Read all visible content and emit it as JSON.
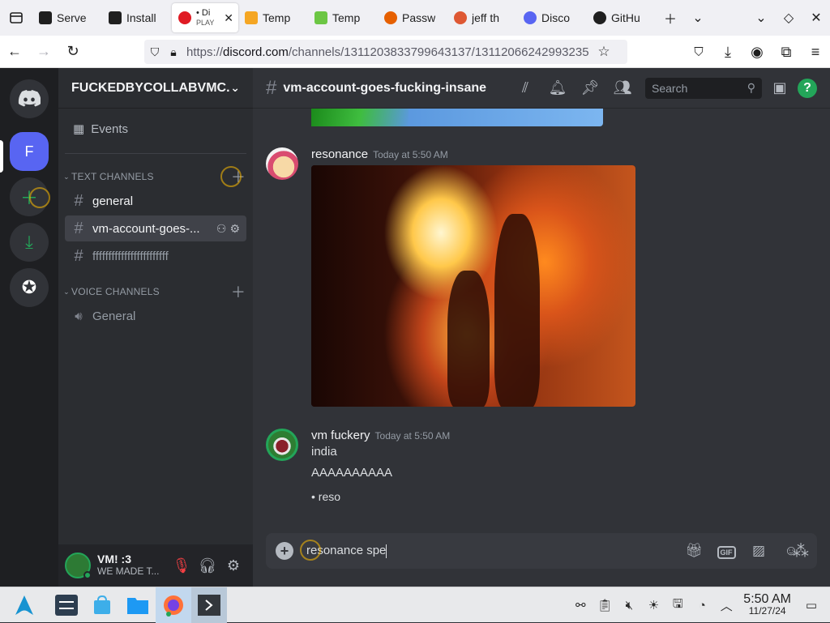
{
  "browser": {
    "tabs": [
      {
        "title": "Serve",
        "color": "#1f1f1f"
      },
      {
        "title": "Install",
        "color": "#1f1f1f"
      },
      {
        "title": "• Di",
        "subtitle": "PLAY",
        "color": "#e01b24",
        "active": true
      },
      {
        "title": "Temp",
        "color": "#f5a623"
      },
      {
        "title": "Temp",
        "color": "#6cc644"
      },
      {
        "title": "Passw",
        "color": "#e66000"
      },
      {
        "title": "jeff th",
        "color": "#de5833"
      },
      {
        "title": "Disco",
        "color": "#5865f2"
      },
      {
        "title": "GitHu",
        "color": "#1f1f1f"
      }
    ],
    "url_prefix": "https://",
    "url_domain": "discord.com",
    "url_rest": "/channels/1311203833799643137/13112066242993235"
  },
  "server": {
    "name": "FUCKEDBYCOLLABVMC...",
    "initial": "F",
    "events_label": "Events",
    "text_category": "TEXT CHANNELS",
    "voice_category": "VOICE CHANNELS",
    "text_channels": [
      {
        "name": "general"
      },
      {
        "name": "vm-account-goes-..."
      },
      {
        "name": "ffffffffffffffffffffffff"
      }
    ],
    "voice_channels": [
      {
        "name": "General"
      }
    ]
  },
  "user": {
    "name": "VM! :3",
    "status": "WE MADE T..."
  },
  "channel": {
    "name": "vm-account-goes-fucking-insane",
    "search_placeholder": "Search"
  },
  "messages": [
    {
      "author": "resonance",
      "time": "Today at 5:50 AM",
      "attachment": "image"
    },
    {
      "author": "vm fuckery",
      "time": "Today at 5:50 AM",
      "lines": [
        "india",
        "AAAAAAAAAA"
      ],
      "bullet": "reso"
    }
  ],
  "composer": {
    "text": "resonance spe"
  },
  "taskbar": {
    "time": "5:50 AM",
    "date": "11/27/24"
  },
  "colors": {
    "blurple": "#5865f2",
    "green": "#23a559",
    "red": "#f23f43"
  }
}
